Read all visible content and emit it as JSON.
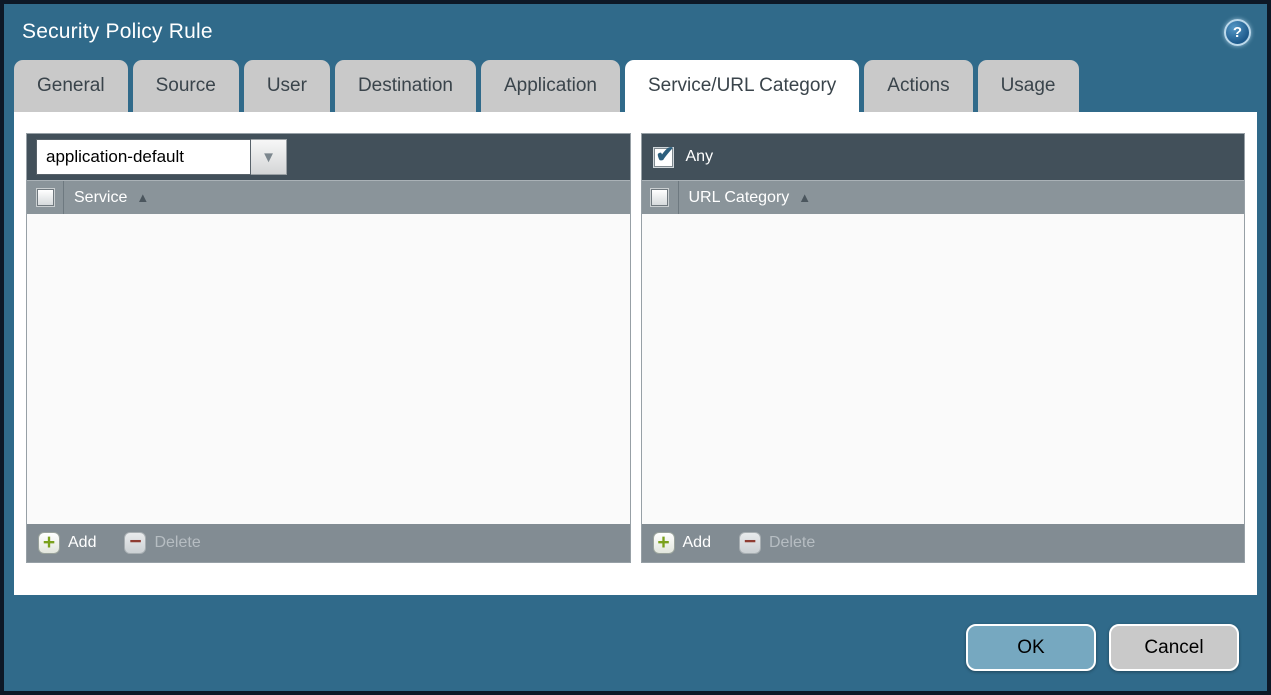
{
  "window": {
    "title": "Security Policy Rule"
  },
  "icons": {
    "help": "?",
    "dropdown_arrow": "▼",
    "sort_asc": "▲",
    "add_plus": "+",
    "delete_minus": "−",
    "checkmark": "✔"
  },
  "tabs": [
    {
      "label": "General",
      "active": false
    },
    {
      "label": "Source",
      "active": false
    },
    {
      "label": "User",
      "active": false
    },
    {
      "label": "Destination",
      "active": false
    },
    {
      "label": "Application",
      "active": false
    },
    {
      "label": "Service/URL Category",
      "active": true
    },
    {
      "label": "Actions",
      "active": false
    },
    {
      "label": "Usage",
      "active": false
    }
  ],
  "service_panel": {
    "dropdown": {
      "value": "application-default"
    },
    "header": {
      "label": "Service",
      "sort": "asc",
      "checkbox_checked": false
    },
    "rows": [],
    "toolbar": {
      "add_label": "Add",
      "delete_label": "Delete",
      "delete_enabled": false
    }
  },
  "url_category_panel": {
    "any": {
      "label": "Any",
      "checked": true
    },
    "header": {
      "label": "URL Category",
      "sort": "asc",
      "checkbox_checked": false
    },
    "rows": [],
    "toolbar": {
      "add_label": "Add",
      "delete_label": "Delete",
      "delete_enabled": false
    }
  },
  "footer": {
    "ok_label": "OK",
    "cancel_label": "Cancel"
  },
  "colors": {
    "dialog_background": "#306a8a",
    "dialog_border": "#0d1826",
    "titlebar_text": "#ffffff",
    "tab_inactive": "#c9c9c9",
    "tab_active": "#ffffff",
    "panel_toolbar_dark": "#42505a",
    "panel_header_gray": "#8a949a",
    "panel_footer_gray": "#828c93",
    "panel_body": "#fafafa",
    "add_icon_green": "#7aa11c",
    "delete_icon_red": "#8f3d33",
    "checkmark_blue": "#2d5f7d",
    "ok_button": "#76a8c0",
    "cancel_button": "#c9c9c9"
  }
}
